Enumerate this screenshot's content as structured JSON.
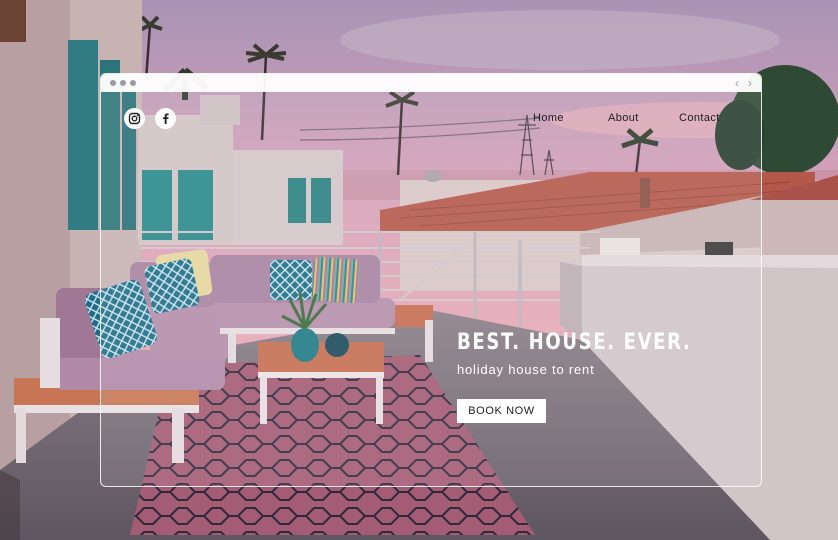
{
  "nav": {
    "items": [
      {
        "label": "Home"
      },
      {
        "label": "About"
      },
      {
        "label": "Contact"
      }
    ],
    "back_arrow": "‹",
    "forward_arrow": "›"
  },
  "social": [
    {
      "icon": "instagram-icon"
    },
    {
      "icon": "facebook-icon",
      "glyph": "f"
    }
  ],
  "hero": {
    "headline": "BEST. HOUSE. EVER.",
    "subheadline": "holiday house to rent",
    "cta_label": "BOOK NOW"
  },
  "colors": {
    "sky_top": "#b7a3b9",
    "sky_bottom": "#e6a7b6",
    "roof": "#b85a48",
    "rug": "#a25a73",
    "cushion_teal": "#1f6f8a",
    "sofa_lilac": "#b58aa8"
  }
}
